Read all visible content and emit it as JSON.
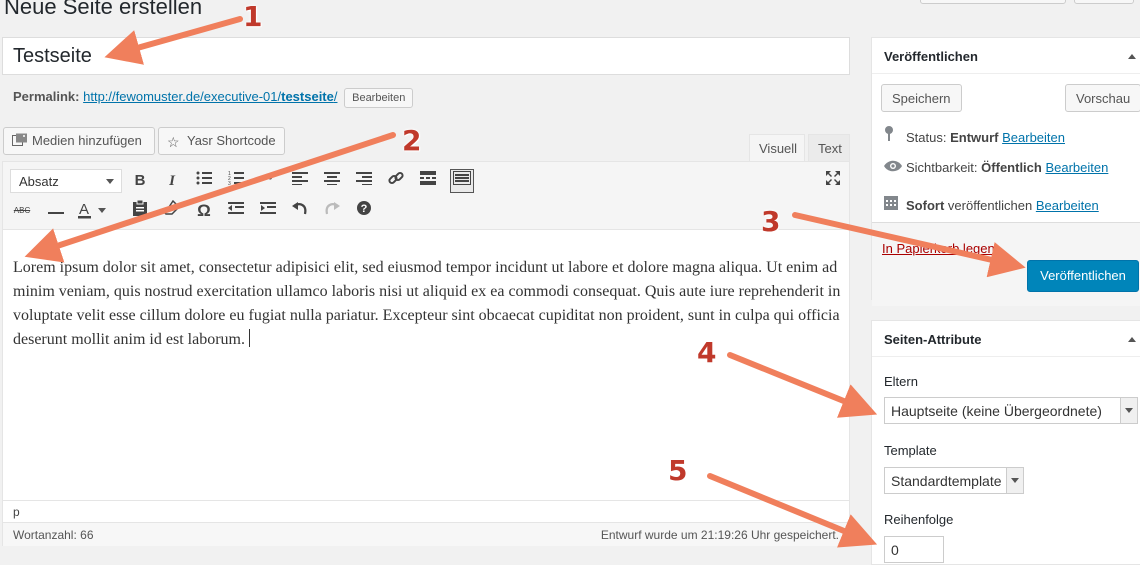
{
  "page": {
    "heading": "Neue Seite erstellen"
  },
  "title": {
    "value": "Testseite"
  },
  "permalink": {
    "label": "Permalink:",
    "url_prefix": "http://fewomuster.de/executive-01/",
    "slug": "testseite",
    "slash": "/",
    "edit_label": "Bearbeiten"
  },
  "media": {
    "add_label": "Medien hinzufügen",
    "shortcode_label": "Yasr Shortcode"
  },
  "editor_tabs": {
    "visual": "Visuell",
    "text": "Text"
  },
  "toolbar": {
    "format_select": "Absatz",
    "row1_icons": [
      "bold-icon",
      "italic-icon",
      "bullet-list-icon",
      "numbered-list-icon",
      "blockquote-icon",
      "align-left-icon",
      "align-center-icon",
      "align-right-icon",
      "link-icon",
      "read-more-icon",
      "toolbar-toggle-icon",
      "fullscreen-icon"
    ],
    "row2_icons": [
      "strikethrough-icon",
      "horizontal-line-icon",
      "text-color-icon",
      "paste-text-icon",
      "clear-formatting-icon",
      "special-character-icon",
      "outdent-icon",
      "indent-icon",
      "undo-icon",
      "redo-icon",
      "help-icon"
    ]
  },
  "content": {
    "text": "Lorem ipsum dolor sit amet, consectetur adipisici elit, sed eiusmod tempor incidunt ut labore et dolore magna aliqua. Ut enim ad minim veniam, quis nostrud exercitation ullamco laboris nisi ut aliquid ex ea commodi consequat. Quis aute iure reprehenderit in voluptate velit esse cillum dolore eu fugiat nulla pariatur. Excepteur sint obcaecat cupiditat non proident, sunt in culpa qui officia deserunt mollit anim id est laborum."
  },
  "path": "p",
  "status_bar": {
    "word_count": "Wortanzahl: 66",
    "saved": "Entwurf wurde um 21:19:26 Uhr gespeichert."
  },
  "publish_box": {
    "title": "Veröffentlichen",
    "save_label": "Speichern",
    "preview_label": "Vorschau",
    "status_label": "Status:",
    "status_value": "Entwurf",
    "visibility_label": "Sichtbarkeit:",
    "visibility_value": "Öffentlich",
    "schedule_bold": "Sofort",
    "schedule_rest": "veröffentlichen",
    "edit_label": "Bearbeiten",
    "trash_label": "In Papierkorb legen",
    "publish_label": "Veröffentlichen"
  },
  "page_attributes": {
    "title": "Seiten-Attribute",
    "parent_label": "Eltern",
    "parent_value": "Hauptseite (keine Übergeordnete)",
    "template_label": "Template",
    "template_value": "Standardtemplate",
    "order_label": "Reihenfolge",
    "order_value": "0"
  },
  "annotations": {
    "m1": "1",
    "m2": "2",
    "m3": "3",
    "m4": "4",
    "m5": "5",
    "arrow_color": "#f07f5c",
    "number_color": "#c0392b"
  },
  "colors": {
    "primary": "#0085ba",
    "link": "#0073aa",
    "trash": "#a00000"
  }
}
